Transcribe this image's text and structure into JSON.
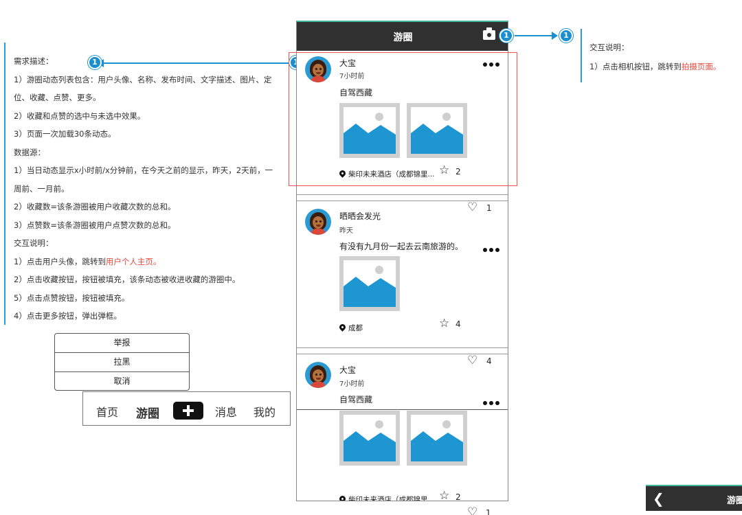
{
  "requirements": {
    "lines": [
      "需求描述：",
      "1）游圈动态列表包含：用户头像、名称、发布时间、文字描述、图片、定",
      "位、收藏、点赞、更多。",
      "2）收藏和点赞的选中与未选中效果。",
      "3）页面一次加载30条动态。",
      "数据源：",
      "1）当日动态显示x小时前/x分钟前，在今天之前的显示，昨天，2天前，一",
      "周前、一月前。",
      "2）收藏数=该条游圈被用户收藏次数的总和。",
      "3）点赞数=该条游圈被用户点赞次数的总和。",
      "交互说明："
    ],
    "avatar_action_prefix": "1）点击用户头像，跳转到",
    "avatar_action_link": "用户个人主页。",
    "more_lines": [
      "2）点击收藏按钮，按钮被填充，该条动态被收进收藏的游圈中。",
      "5）点击点赞按钮，按钮被填充。",
      "4）点击更多按钮，弹出弹框。"
    ]
  },
  "marker_number": "1",
  "interaction": {
    "title": "交互说明：",
    "camera_prefix": "1）点击相机按钮，跳转到",
    "camera_link": "拍摄页面。"
  },
  "popup": {
    "items": [
      "举报",
      "拉黑",
      "取消"
    ]
  },
  "tabbar": {
    "home": "首页",
    "circle": "游圈",
    "messages": "消息",
    "mine": "我的"
  },
  "phone": {
    "title": "游圈",
    "posts": [
      {
        "name": "大宝",
        "time": "7小时前",
        "text": "自驾西藏",
        "location": "柴印未来酒店（成都锦里...",
        "star_count": "2",
        "like_count": "1"
      },
      {
        "name": "晒晒会发光",
        "time": "昨天",
        "text": "有没有九月份一起去云南旅游的。",
        "location": "成都",
        "star_count": "4",
        "like_count": "4"
      },
      {
        "name": "大宝",
        "time": "7小时前",
        "text": "自驾西藏",
        "location": "柴印未来酒店（成都锦里...",
        "star_count": "2",
        "like_count": "1"
      }
    ]
  },
  "second_screen": {
    "title": "游圈"
  },
  "colors": {
    "accent": "#1a8fd0",
    "link_red": "#e8483c",
    "nav_dark": "#303030",
    "nav_line": "#3bb89e",
    "image_blue": "#1e96d2",
    "highlight_red": "#e8555a"
  },
  "icons": [
    "camera-icon",
    "more-icon",
    "location-pin-icon",
    "star-icon",
    "heart-icon",
    "plus-icon",
    "back-icon",
    "image-placeholder-icon"
  ]
}
